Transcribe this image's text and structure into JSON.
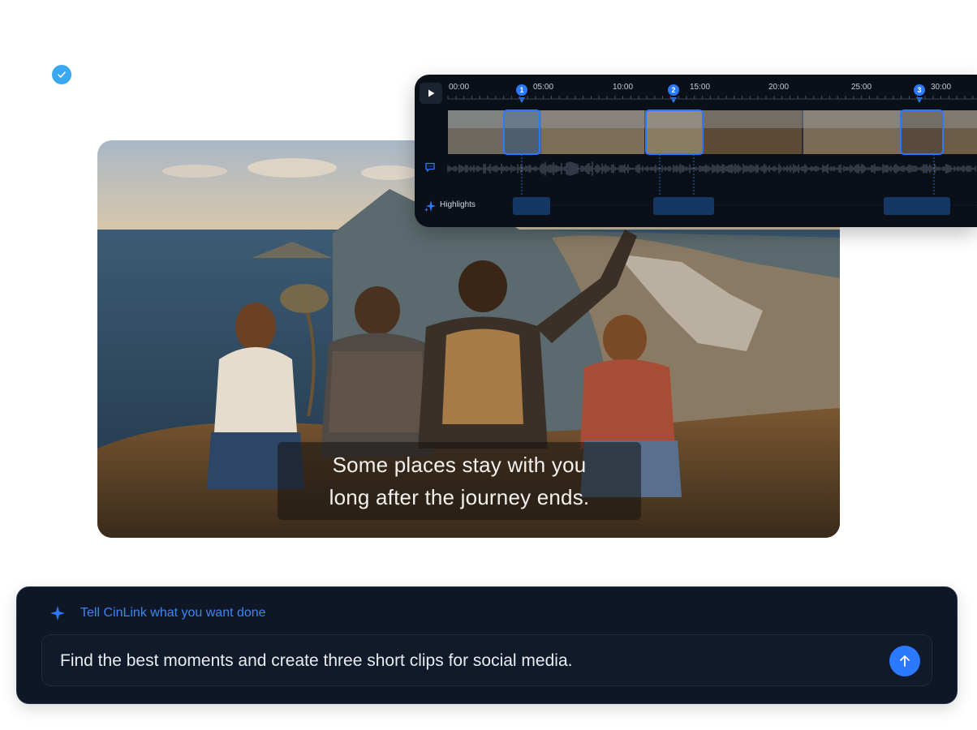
{
  "subtitle": {
    "line1": "Some places stay with you",
    "line2": "long after the journey ends."
  },
  "timeline": {
    "ticks": [
      "00:00",
      "05:00",
      "10:00",
      "15:00",
      "20:00",
      "25:00",
      "30:00"
    ],
    "markers": [
      "1",
      "2",
      "3"
    ],
    "highlights_label": "Highlights",
    "play_icon": "play-icon",
    "transcript_icon": "chat-icon",
    "highlights_icon": "sparkle-icon",
    "accent": "#2b79ff"
  },
  "prompt": {
    "hint": "Tell CinLink what you want done",
    "value": "Find the best moments and create three short clips for social media.",
    "send_icon": "arrow-up-icon",
    "hint_icon": "sparkle-icon"
  },
  "status": {
    "icon": "check-icon",
    "color": "#3aa7f2"
  }
}
